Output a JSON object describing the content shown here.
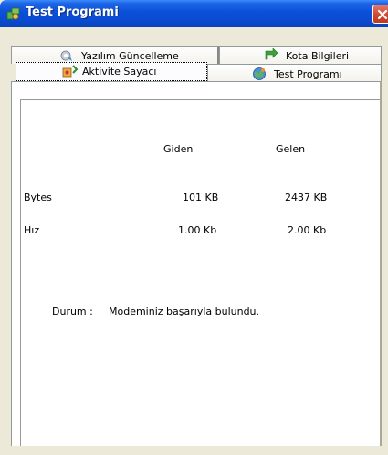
{
  "window": {
    "title": "Test Programi"
  },
  "tabs": {
    "row1": [
      {
        "label": "Yazılım Güncelleme",
        "icon": "software-update-icon"
      },
      {
        "label": "Kota Bilgileri",
        "icon": "green-arrow-icon"
      }
    ],
    "row2": [
      {
        "label": "Aktivite Sayacı",
        "icon": "activity-counter-icon",
        "selected": true
      },
      {
        "label": "Test Programı",
        "icon": "globe-icon"
      }
    ]
  },
  "stats": {
    "col_sent": "Giden",
    "col_received": "Gelen",
    "rows": [
      {
        "label": "Bytes",
        "sent": "101 KB",
        "received": "2437 KB"
      },
      {
        "label": "Hız",
        "sent": "1.00 Kb",
        "received": "2.00 Kb"
      }
    ]
  },
  "status": {
    "label": "Durum :",
    "message": "Modeminiz başarıyla bulundu."
  },
  "colors": {
    "titlebar": "#0A50D8",
    "close": "#D04A32",
    "panel": "#FFFFFF",
    "frame": "#ECE9D8"
  }
}
